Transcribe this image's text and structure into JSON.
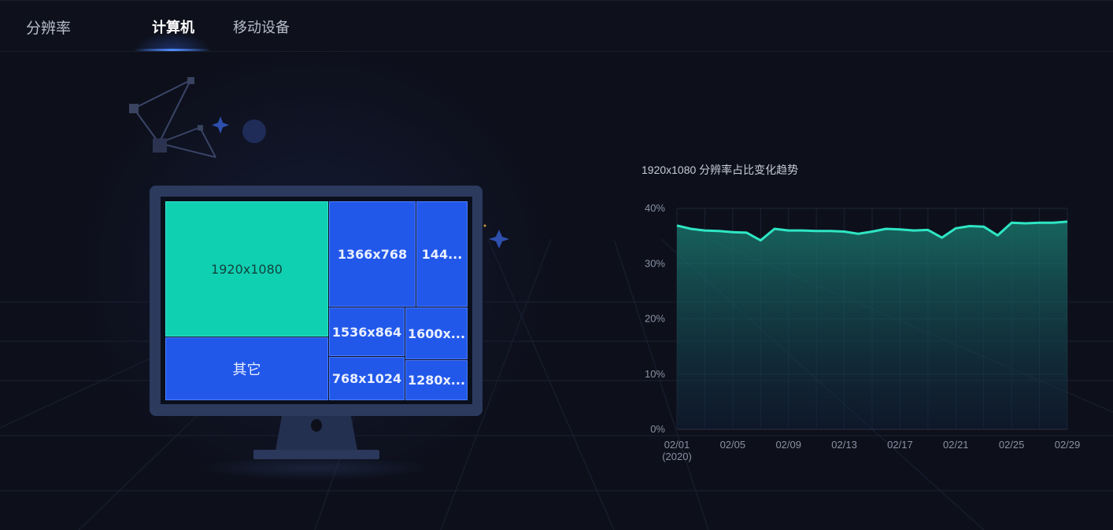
{
  "header": {
    "section_title": "分辨率",
    "tabs": [
      {
        "label": "计算机",
        "active": true
      },
      {
        "label": "移动设备",
        "active": false
      }
    ]
  },
  "colors": {
    "accent": "#2258ea",
    "highlight": "#10d0b2",
    "line": "#2ee6c4",
    "background": "#0d101b"
  },
  "treemap": {
    "tiles": [
      {
        "label": "1920x1080",
        "kind": "primary"
      },
      {
        "label": "1366x768",
        "kind": "normal"
      },
      {
        "label": "144...",
        "kind": "normal"
      },
      {
        "label": "1536x864",
        "kind": "normal"
      },
      {
        "label": "1600x...",
        "kind": "normal"
      },
      {
        "label": "其它",
        "kind": "other"
      },
      {
        "label": "768x1024",
        "kind": "normal"
      },
      {
        "label": "1280x...",
        "kind": "normal"
      }
    ]
  },
  "chart_data": {
    "type": "area",
    "title": "1920x1080 分辨率占比变化趋势",
    "xlabel": "",
    "ylabel": "",
    "ylim": [
      0,
      40
    ],
    "y_ticks": [
      "0%",
      "10%",
      "20%",
      "30%",
      "40%"
    ],
    "x_ticks": [
      "02/01",
      "02/05",
      "02/09",
      "02/13",
      "02/17",
      "02/21",
      "02/25",
      "02/29"
    ],
    "x_tick_sublabel": "(2020)",
    "grid": true,
    "x": [
      "02/01",
      "02/02",
      "02/03",
      "02/04",
      "02/05",
      "02/06",
      "02/07",
      "02/08",
      "02/09",
      "02/10",
      "02/11",
      "02/12",
      "02/13",
      "02/14",
      "02/15",
      "02/16",
      "02/17",
      "02/18",
      "02/19",
      "02/20",
      "02/21",
      "02/22",
      "02/23",
      "02/24",
      "02/25",
      "02/26",
      "02/27",
      "02/28",
      "02/29"
    ],
    "series": [
      {
        "values": [
          36.9,
          36.3,
          36.0,
          35.9,
          35.7,
          35.6,
          34.2,
          36.3,
          36.0,
          36.0,
          35.9,
          35.9,
          35.8,
          35.4,
          35.8,
          36.3,
          36.2,
          36.0,
          36.1,
          34.7,
          36.4,
          36.8,
          36.7,
          35.1,
          37.4,
          37.3,
          37.4,
          37.4,
          37.6
        ]
      }
    ]
  }
}
